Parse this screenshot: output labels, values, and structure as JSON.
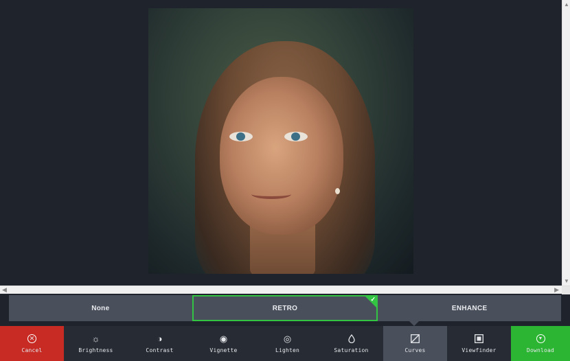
{
  "presets": [
    {
      "label": "None",
      "active": false
    },
    {
      "label": "RETRO",
      "active": true
    },
    {
      "label": "ENHANCE",
      "active": false
    }
  ],
  "tools": [
    {
      "label": "Cancel",
      "icon": "cancel-icon"
    },
    {
      "label": "Brightness",
      "icon": "sun-icon"
    },
    {
      "label": "Contrast",
      "icon": "contrast-icon"
    },
    {
      "label": "Vignette",
      "icon": "vignette-icon"
    },
    {
      "label": "Lighten",
      "icon": "lighten-icon"
    },
    {
      "label": "Saturation",
      "icon": "drop-icon"
    },
    {
      "label": "Curves",
      "icon": "curves-icon"
    },
    {
      "label": "Viewfinder",
      "icon": "viewfinder-icon"
    },
    {
      "label": "Download",
      "icon": "download-icon"
    }
  ],
  "colors": {
    "accent": "#33c443",
    "cancel": "#c72b24",
    "download": "#2cb533",
    "background": "#1f232b"
  }
}
